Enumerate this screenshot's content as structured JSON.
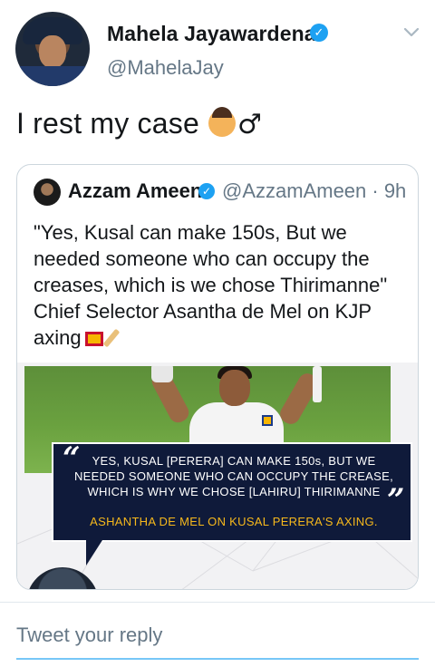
{
  "tweet": {
    "author": {
      "display_name": "Mahela Jayawardena",
      "handle": "@MahelaJay",
      "verified": true
    },
    "text": "I rest my case",
    "emoji": [
      "person-facepalming-emoji",
      "male-sign-emoji"
    ],
    "male_sign": "♂"
  },
  "quoted_tweet": {
    "author": {
      "display_name": "Azzam Ameen",
      "handle": "@AzzamAmeen · 9h",
      "verified": true
    },
    "text": "\"Yes, Kusal can make 150s, But we needed someone who can occupy the creases, which is we chose Thirimanne\" Chief Selector Asantha de Mel on KJP axing",
    "media": {
      "quote_line": "YES, KUSAL [PERERA] CAN MAKE 150s, BUT WE NEEDED SOMEONE WHO CAN OCCUPY THE CREASE, WHICH IS WHY WE CHOSE [LAHIRU] THIRIMANNE",
      "attribution": "ASHANTHA DE MEL ON KUSAL PERERA'S AXING.",
      "quote_open": "“",
      "quote_close": "”"
    }
  },
  "reply": {
    "placeholder": "Tweet your reply"
  },
  "colors": {
    "accent": "#1da1f2",
    "card_bg": "#0f1a3a",
    "attribution": "#f6b81c",
    "secondary_text": "#657786"
  }
}
